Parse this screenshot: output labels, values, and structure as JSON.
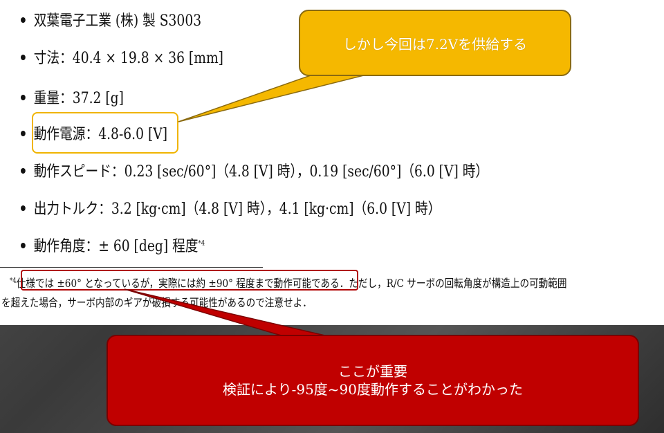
{
  "specs": [
    {
      "text": "双葉電子工業 (株) 製 S3003"
    },
    {
      "text": "寸法：40.4 × 19.8 × 36 [mm]"
    },
    {
      "text": "重量：37.2 [g]"
    },
    {
      "text": "動作電源：4.8-6.0 [V]"
    },
    {
      "text": "動作スピード：0.23 [sec/60°]（4.8 [V] 時），0.19 [sec/60°]（6.0 [V] 時）"
    },
    {
      "text": "出力トルク：3.2 [kg·cm]（4.8 [V] 時），4.1 [kg·cm]（6.0 [V] 時）"
    },
    {
      "text": "動作角度：± 60 [deg] 程度",
      "sup": "*4"
    }
  ],
  "footnote": {
    "marker": "*4",
    "line1": "仕様では ±60° となっているが，実際には約 ±90° 程度まで動作可能である．ただし，R/C サーボの回転角度が構造上の可動範囲",
    "line2": "を超えた場合，サーボ内部のギアが破損する可能性があるので注意せよ．"
  },
  "callouts": {
    "top": "しかし今回は7.2Vを供給する",
    "bottom_line1": "ここが重要",
    "bottom_line2": "検証により-95度~90度動作することがわかった"
  },
  "colors": {
    "callout_top": "#f5b800",
    "callout_bottom": "#c00000",
    "highlight_yellow": "#f0b400",
    "highlight_red": "#b00000"
  }
}
